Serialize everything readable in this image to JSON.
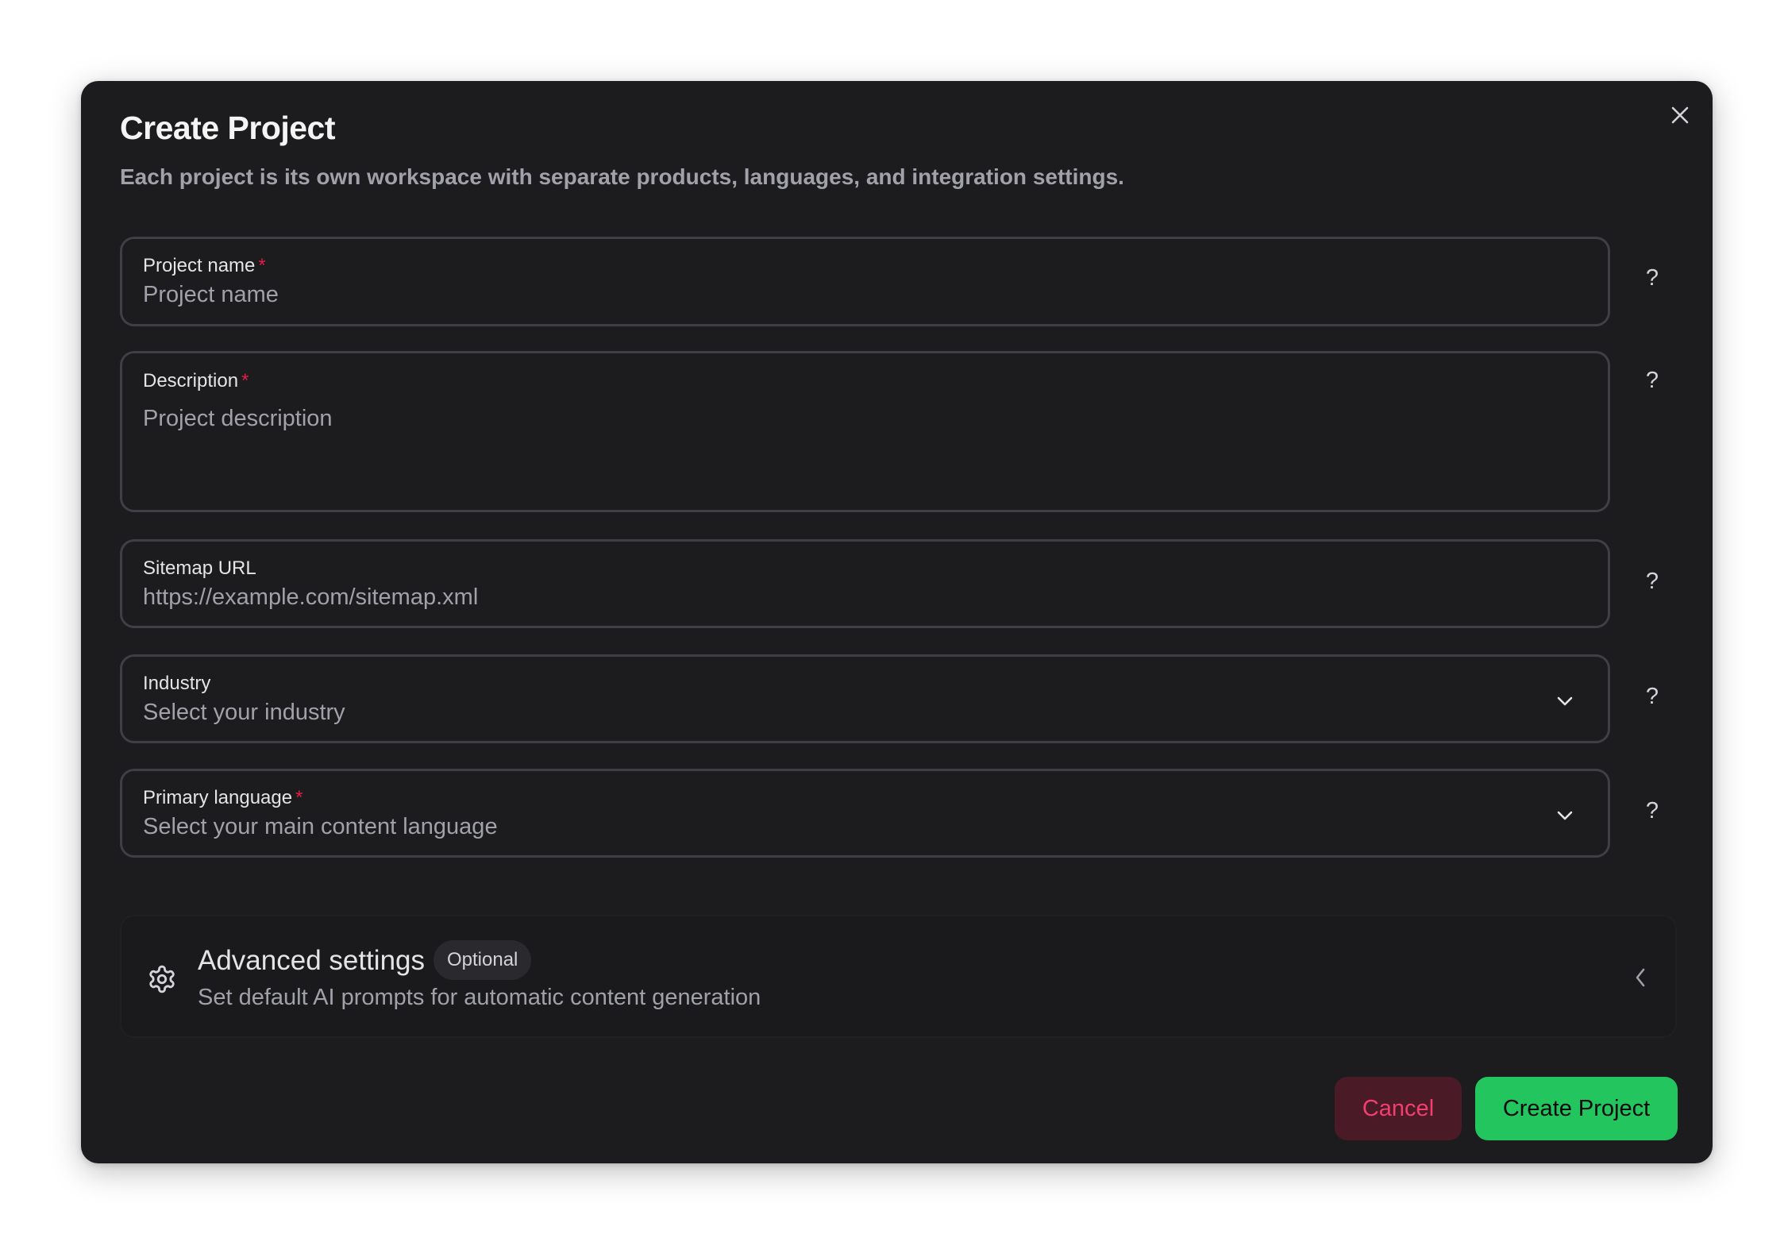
{
  "dialog": {
    "title": "Create Project",
    "subtitle": "Each project is its own workspace with separate products, languages, and integration settings.",
    "close_icon": "close-icon"
  },
  "fields": {
    "project_name": {
      "label": "Project name",
      "required_mark": "*",
      "placeholder": "Project name",
      "value": ""
    },
    "description": {
      "label": "Description",
      "required_mark": "*",
      "placeholder": "Project description",
      "value": ""
    },
    "sitemap_url": {
      "label": "Sitemap URL",
      "placeholder": "https://example.com/sitemap.xml",
      "value": ""
    },
    "industry": {
      "label": "Industry",
      "placeholder": "Select your industry",
      "icon": "chevron-down-icon"
    },
    "primary_language": {
      "label": "Primary language",
      "required_mark": "*",
      "placeholder": "Select your main content language",
      "icon": "chevron-down-icon"
    }
  },
  "help": {
    "glyph": "?",
    "icon": "help-icon"
  },
  "advanced": {
    "icon": "gear-icon",
    "title": "Advanced settings",
    "badge": "Optional",
    "description": "Set default AI prompts for automatic content generation",
    "toggle_icon": "chevron-left-icon"
  },
  "actions": {
    "cancel_label": "Cancel",
    "create_label": "Create Project"
  },
  "colors": {
    "modal_bg": "#1c1c1e",
    "border": "#3f3f46",
    "required": "#e11d48",
    "primary": "#22c55e",
    "cancel_bg": "#4a1a26",
    "cancel_text": "#f43f6e"
  }
}
